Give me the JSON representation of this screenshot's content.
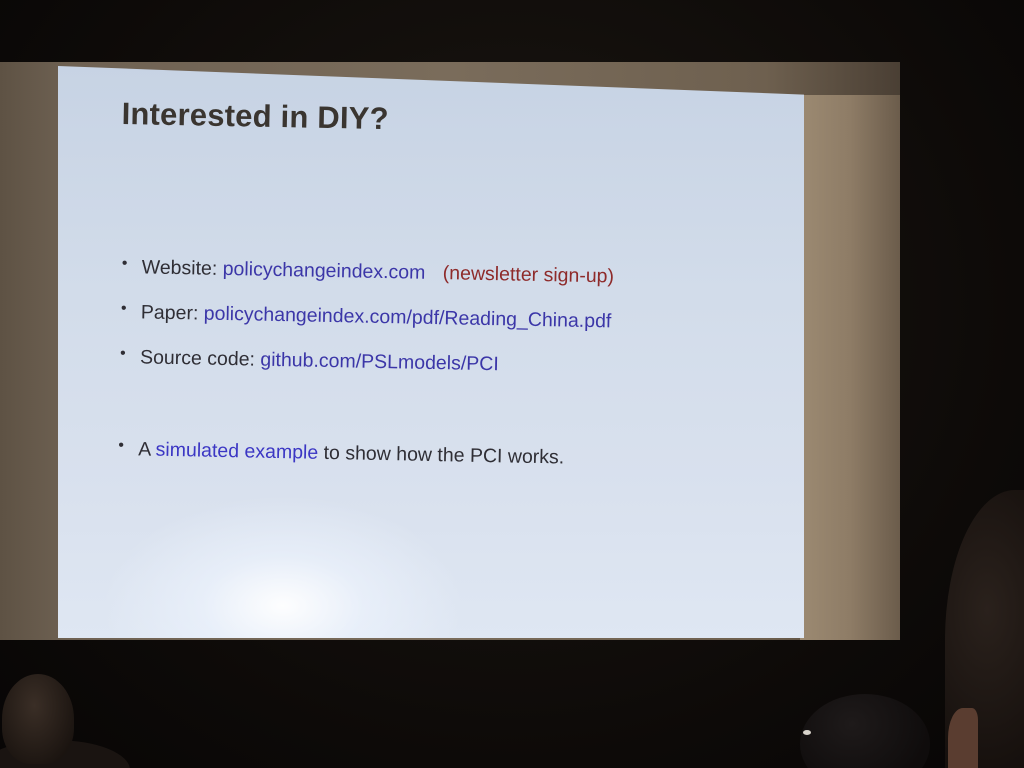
{
  "slide": {
    "title": "Interested in DIY?",
    "bullets": [
      {
        "label": "Website:",
        "link": "policychangeindex.com",
        "note": "(newsletter sign-up)"
      },
      {
        "label": "Paper:",
        "link": "policychangeindex.com/pdf/Reading_China.pdf"
      },
      {
        "label": "Source code:",
        "link": "github.com/PSLmodels/PCI"
      }
    ],
    "example": {
      "prefix": "A",
      "highlight": "simulated example",
      "suffix": "to show how the PCI works."
    },
    "bullet_symbol": "•"
  },
  "colors": {
    "slide_background": "#d2dcea",
    "title_text": "#3a3530",
    "link_text": "#3b36a8",
    "note_text": "#8e2a2a",
    "room_dark": "#0b0908"
  }
}
